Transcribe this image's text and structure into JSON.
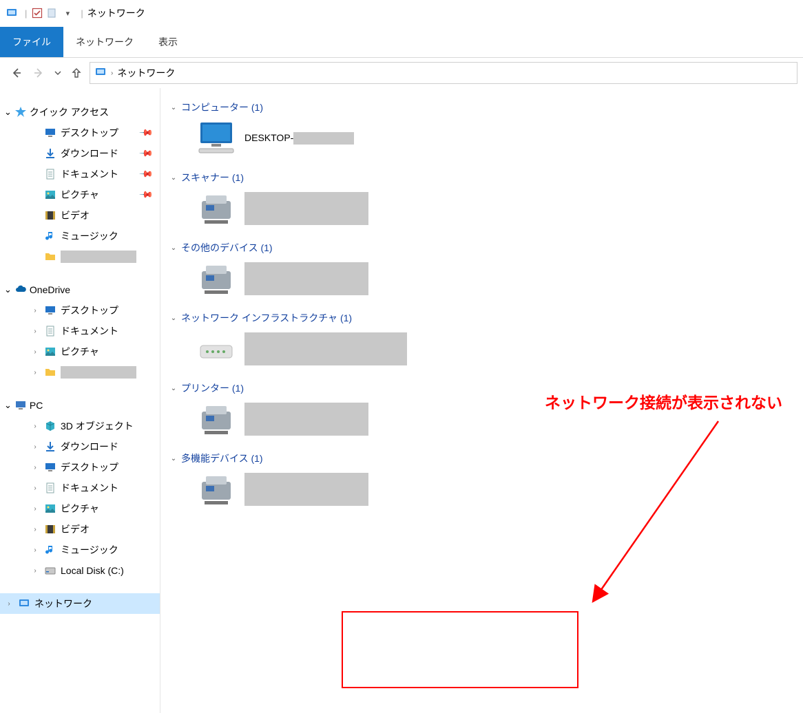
{
  "titlebar": {
    "title": "ネットワーク",
    "qat_dropdown": "▾"
  },
  "ribbon": {
    "file": "ファイル",
    "tab_network": "ネットワーク",
    "tab_view": "表示"
  },
  "nav": {
    "breadcrumb_root": "ネットワーク"
  },
  "tree": {
    "quick_access": "クイック アクセス",
    "qa_items": [
      {
        "label": "デスクトップ",
        "icon": "desktop",
        "pinned": true
      },
      {
        "label": "ダウンロード",
        "icon": "download",
        "pinned": true
      },
      {
        "label": "ドキュメント",
        "icon": "document",
        "pinned": true
      },
      {
        "label": "ピクチャ",
        "icon": "pictures",
        "pinned": true
      },
      {
        "label": "ビデオ",
        "icon": "video",
        "pinned": false
      },
      {
        "label": "ミュージック",
        "icon": "music",
        "pinned": false
      },
      {
        "label": "",
        "icon": "folder",
        "pinned": false,
        "redacted": true
      }
    ],
    "onedrive": "OneDrive",
    "od_items": [
      {
        "label": "デスクトップ",
        "icon": "desktop"
      },
      {
        "label": "ドキュメント",
        "icon": "document"
      },
      {
        "label": "ピクチャ",
        "icon": "pictures"
      },
      {
        "label": "",
        "icon": "folder",
        "redacted": true
      }
    ],
    "pc": "PC",
    "pc_items": [
      {
        "label": "3D オブジェクト",
        "icon": "3d"
      },
      {
        "label": "ダウンロード",
        "icon": "download"
      },
      {
        "label": "デスクトップ",
        "icon": "desktop"
      },
      {
        "label": "ドキュメント",
        "icon": "document"
      },
      {
        "label": "ピクチャ",
        "icon": "pictures"
      },
      {
        "label": "ビデオ",
        "icon": "video"
      },
      {
        "label": "ミュージック",
        "icon": "music"
      },
      {
        "label": "Local Disk (C:)",
        "icon": "disk"
      }
    ],
    "network": "ネットワーク"
  },
  "groups": {
    "computer": {
      "label": "コンピューター (1)",
      "item_label": "DESKTOP-"
    },
    "scanner": {
      "label": "スキャナー (1)"
    },
    "other": {
      "label": "その他のデバイス (1)"
    },
    "infra": {
      "label": "ネットワーク インフラストラクチャ (1)"
    },
    "printer": {
      "label": "プリンター (1)"
    },
    "multifunc": {
      "label": "多機能デバイス (1)"
    }
  },
  "annotation": {
    "text": "ネットワーク接続が表示されない"
  }
}
